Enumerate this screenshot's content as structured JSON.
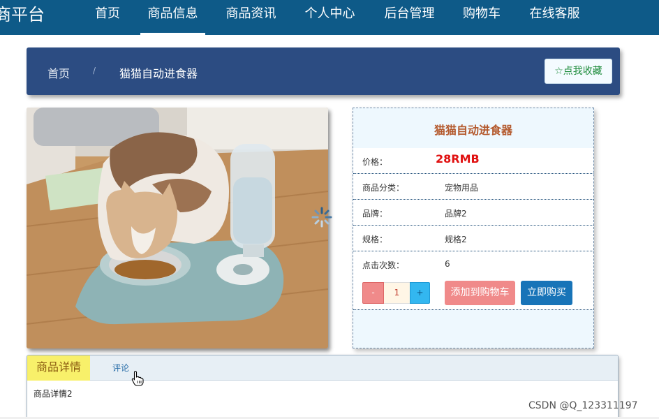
{
  "nav": {
    "brand": "商平台",
    "items": [
      "首页",
      "商品信息",
      "商品资讯",
      "个人中心",
      "后台管理",
      "购物车",
      "在线客服"
    ],
    "active": "商品信息"
  },
  "breadcrumb": {
    "home": "首页",
    "separator": "/",
    "current": "猫猫自动进食器",
    "favorite_label": "点我收藏",
    "favorite_icon": "star-outline-icon"
  },
  "product": {
    "name": "猫猫自动进食器",
    "price_label": "价格：",
    "price": "28RMB",
    "fields": [
      {
        "label": "商品分类：",
        "value": "宠物用品"
      },
      {
        "label": "品牌：",
        "value": "品牌2"
      },
      {
        "label": "规格：",
        "value": "规格2"
      },
      {
        "label": "点击次数：",
        "value": "6"
      }
    ],
    "quantity": {
      "minus": "-",
      "value": "1",
      "plus": "+"
    },
    "add_to_cart": "添加到购物车",
    "buy_now": "立即购买"
  },
  "tabs": {
    "items": [
      "商品详情",
      "评论"
    ],
    "active": "商品详情",
    "content": "商品详情2"
  },
  "watermark": "CSDN @Q_123311197",
  "colors": {
    "nav_bg": "#0e5a88",
    "breadcrumb_bg": "#2c4c82",
    "price": "#e01010",
    "title": "#b45a2e",
    "cart_button": "#f08a8a",
    "buy_button": "#1874b8",
    "active_tab": "#f8f06a"
  }
}
